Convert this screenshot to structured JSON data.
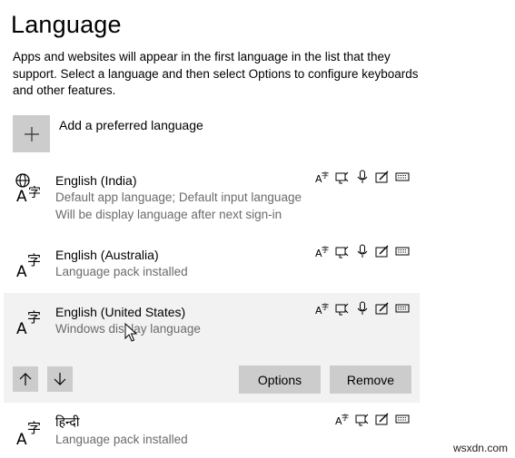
{
  "page": {
    "title": "Language",
    "description": "Apps and websites will appear in the first language in the list that they support. Select a language and then select Options to configure keyboards and other features."
  },
  "add_language": {
    "label": "Add a preferred language",
    "icon": "plus-icon"
  },
  "languages": [
    {
      "name": "English (India)",
      "details": [
        "Default app language; Default input language",
        "Will be display language after next sign-in"
      ],
      "icon": "globe-language-icon",
      "features": [
        "language-pack",
        "text-to-speech",
        "speech-recognition",
        "handwriting",
        "keyboard"
      ]
    },
    {
      "name": "English (Australia)",
      "details": [
        "Language pack installed"
      ],
      "icon": "language-icon",
      "features": [
        "language-pack",
        "text-to-speech",
        "speech-recognition",
        "handwriting",
        "keyboard"
      ]
    },
    {
      "name": "English (United States)",
      "details": [
        "Windows display language"
      ],
      "icon": "language-icon",
      "selected": true,
      "features": [
        "language-pack",
        "text-to-speech",
        "speech-recognition",
        "handwriting",
        "keyboard"
      ]
    },
    {
      "name": "हिन्दी",
      "details": [
        "Language pack installed"
      ],
      "icon": "language-icon",
      "features": [
        "language-pack",
        "text-to-speech",
        "handwriting",
        "keyboard"
      ]
    }
  ],
  "actions": {
    "options": "Options",
    "remove": "Remove",
    "move_up": "arrow-up-icon",
    "move_down": "arrow-down-icon"
  },
  "watermark": "wsxdn.com",
  "colors": {
    "button_bg": "#cccccc",
    "selected_bg": "#f2f2f2",
    "secondary_text": "#6b6b6b"
  }
}
